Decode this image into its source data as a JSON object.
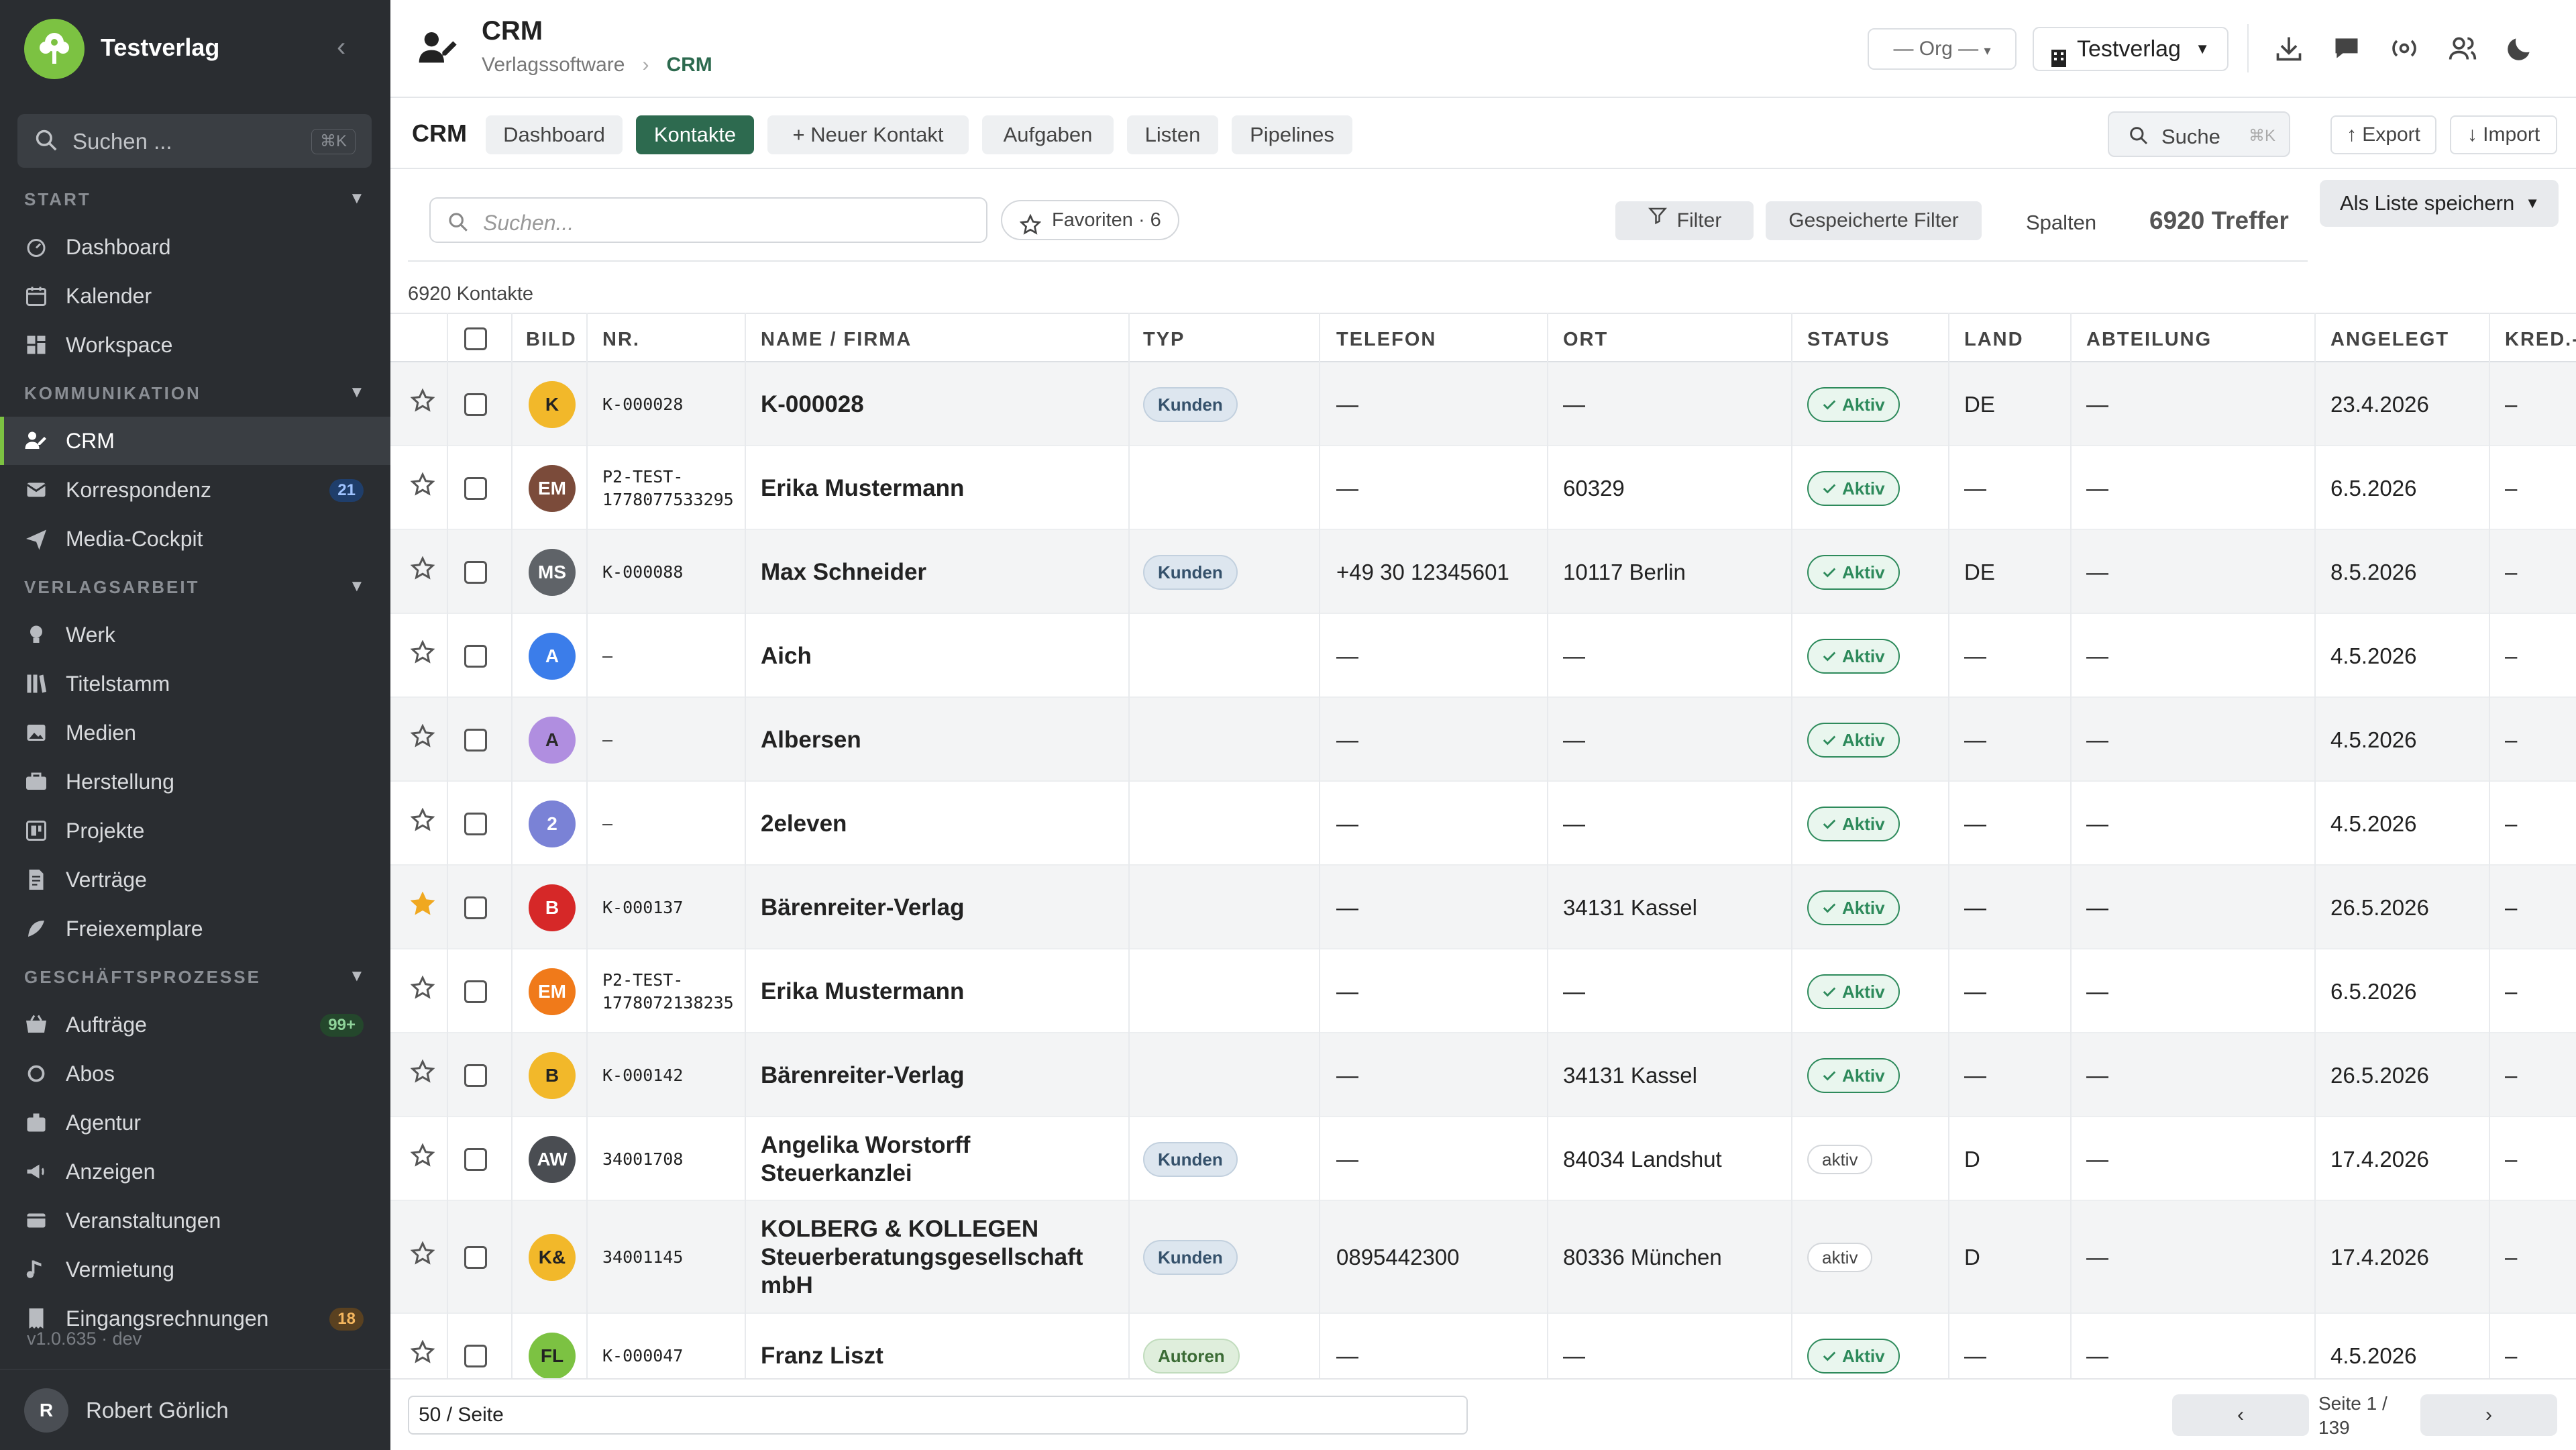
{
  "sidebar": {
    "brand": "Testverlag",
    "search_placeholder": "Suchen ...",
    "search_shortcut": "⌘K",
    "sections": [
      {
        "title": "START",
        "items": [
          {
            "label": "Dashboard",
            "icon": "dashboard-icon"
          },
          {
            "label": "Kalender",
            "icon": "calendar-icon"
          },
          {
            "label": "Workspace",
            "icon": "workspace-icon"
          }
        ]
      },
      {
        "title": "KOMMUNIKATION",
        "items": [
          {
            "label": "CRM",
            "icon": "crm-icon",
            "active": true
          },
          {
            "label": "Korrespondenz",
            "icon": "mail-icon",
            "badge": "21"
          },
          {
            "label": "Media-Cockpit",
            "icon": "send-icon"
          }
        ]
      },
      {
        "title": "VERLAGSARBEIT",
        "items": [
          {
            "label": "Werk",
            "icon": "bulb-icon"
          },
          {
            "label": "Titelstamm",
            "icon": "books-icon"
          },
          {
            "label": "Medien",
            "icon": "image-icon"
          },
          {
            "label": "Herstellung",
            "icon": "briefcase-icon"
          },
          {
            "label": "Projekte",
            "icon": "project-icon"
          },
          {
            "label": "Verträge",
            "icon": "contract-icon"
          },
          {
            "label": "Freiexemplare",
            "icon": "feather-icon"
          }
        ]
      },
      {
        "title": "GESCHÄFTSPROZESSE",
        "items": [
          {
            "label": "Aufträge",
            "icon": "orders-icon",
            "badge": "99+"
          },
          {
            "label": "Abos",
            "icon": "refresh-icon"
          },
          {
            "label": "Agentur",
            "icon": "agency-icon"
          },
          {
            "label": "Anzeigen",
            "icon": "megaphone-icon"
          },
          {
            "label": "Veranstaltungen",
            "icon": "event-icon"
          },
          {
            "label": "Vermietung",
            "icon": "music-icon"
          },
          {
            "label": "Eingangsrechnungen",
            "icon": "invoice-icon",
            "badge": "18"
          }
        ]
      }
    ],
    "version": "v1.0.635 · dev",
    "user": {
      "initial": "R",
      "name": "Robert Görlich"
    }
  },
  "header": {
    "title": "CRM",
    "breadcrumb": [
      "Verlagssoftware",
      "CRM"
    ],
    "org_select": "— Org —",
    "publisher_select": "Testverlag"
  },
  "subnav": {
    "title": "CRM",
    "tabs": [
      "Dashboard",
      "Kontakte",
      "+ Neuer Kontakt",
      "Aufgaben",
      "Listen",
      "Pipelines"
    ],
    "active_tab": "Kontakte",
    "search_label": "Suche",
    "search_shortcut": "⌘K",
    "export_label": "↑ Export",
    "import_label": "↓ Import"
  },
  "toolbar": {
    "search_placeholder": "Suchen...",
    "favorites_label": "Favoriten · 6",
    "filter_label": "Filter",
    "saved_filters_label": "Gespeicherte Filter",
    "columns_label": "Spalten",
    "hits": "6920 Treffer",
    "save_as_list": "Als Liste speichern"
  },
  "count_label": "6920 Kontakte",
  "table": {
    "columns": [
      "BILD",
      "NR.",
      "NAME / FIRMA",
      "TYP",
      "TELEFON",
      "ORT",
      "STATUS",
      "LAND",
      "ABTEILUNG",
      "ANGELEGT",
      "KRED.-"
    ],
    "rows": [
      {
        "initials": "K",
        "av_color": "#f2b82a",
        "av_text": "#222222",
        "nr": [
          "K-000028"
        ],
        "name": [
          "K-000028"
        ],
        "typ": "Kunden",
        "telefon": "—",
        "ort": "—",
        "status": "Aktiv",
        "land": "DE",
        "abteilung": "—",
        "angelegt": "23.4.2026",
        "kred": "–",
        "starred": false
      },
      {
        "initials": "EM",
        "av_color": "#7b4b3a",
        "av_text": "#ffffff",
        "nr": [
          "P2-TEST-",
          "1778077533295"
        ],
        "name": [
          "Erika Mustermann"
        ],
        "typ": "",
        "telefon": "—",
        "ort": "60329",
        "status": "Aktiv",
        "land": "—",
        "abteilung": "—",
        "angelegt": "6.5.2026",
        "kred": "–",
        "starred": false
      },
      {
        "initials": "MS",
        "av_color": "#5f6368",
        "av_text": "#ffffff",
        "nr": [
          "K-000088"
        ],
        "name": [
          "Max Schneider"
        ],
        "typ": "Kunden",
        "telefon": "+49 30 12345601",
        "ort": "10117 Berlin",
        "status": "Aktiv",
        "land": "DE",
        "abteilung": "—",
        "angelegt": "8.5.2026",
        "kred": "–",
        "starred": false
      },
      {
        "initials": "A",
        "av_color": "#3b7dea",
        "av_text": "#ffffff",
        "nr": [
          "–"
        ],
        "name": [
          "Aich"
        ],
        "typ": "",
        "telefon": "—",
        "ort": "—",
        "status": "Aktiv",
        "land": "—",
        "abteilung": "—",
        "angelegt": "4.5.2026",
        "kred": "–",
        "starred": false
      },
      {
        "initials": "A",
        "av_color": "#b08ee0",
        "av_text": "#2a2a2a",
        "nr": [
          "–"
        ],
        "name": [
          "Albersen"
        ],
        "typ": "",
        "telefon": "—",
        "ort": "—",
        "status": "Aktiv",
        "land": "—",
        "abteilung": "—",
        "angelegt": "4.5.2026",
        "kred": "–",
        "starred": false
      },
      {
        "initials": "2",
        "av_color": "#7a82d6",
        "av_text": "#ffffff",
        "nr": [
          "–"
        ],
        "name": [
          "2eleven"
        ],
        "typ": "",
        "telefon": "—",
        "ort": "—",
        "status": "Aktiv",
        "land": "—",
        "abteilung": "—",
        "angelegt": "4.5.2026",
        "kred": "–",
        "starred": false
      },
      {
        "initials": "B",
        "av_color": "#d62828",
        "av_text": "#ffffff",
        "nr": [
          "K-000137"
        ],
        "name": [
          "Bärenreiter-Verlag"
        ],
        "typ": "",
        "telefon": "—",
        "ort": "34131 Kassel",
        "status": "Aktiv",
        "land": "—",
        "abteilung": "—",
        "angelegt": "26.5.2026",
        "kred": "–",
        "starred": true
      },
      {
        "initials": "EM",
        "av_color": "#f07a1a",
        "av_text": "#ffffff",
        "nr": [
          "P2-TEST-",
          "1778072138235"
        ],
        "name": [
          "Erika Mustermann"
        ],
        "typ": "",
        "telefon": "—",
        "ort": "—",
        "status": "Aktiv",
        "land": "—",
        "abteilung": "—",
        "angelegt": "6.5.2026",
        "kred": "–",
        "starred": false
      },
      {
        "initials": "B",
        "av_color": "#f2b82a",
        "av_text": "#222222",
        "nr": [
          "K-000142"
        ],
        "name": [
          "Bärenreiter-Verlag"
        ],
        "typ": "",
        "telefon": "—",
        "ort": "34131 Kassel",
        "status": "Aktiv",
        "land": "—",
        "abteilung": "—",
        "angelegt": "26.5.2026",
        "kred": "–",
        "starred": false
      },
      {
        "initials": "AW",
        "av_color": "#4a4d52",
        "av_text": "#ffffff",
        "nr": [
          "34001708"
        ],
        "name": [
          "Angelika Worstorff",
          "Steuerkanzlei"
        ],
        "typ": "Kunden",
        "telefon": "—",
        "ort": "84034 Landshut",
        "status": "aktiv",
        "land": "D",
        "abteilung": "—",
        "angelegt": "17.4.2026",
        "kred": "–",
        "starred": false
      },
      {
        "initials": "K&",
        "av_color": "#f2b82a",
        "av_text": "#222222",
        "nr": [
          "34001145"
        ],
        "name": [
          "KOLBERG & KOLLEGEN",
          "Steuerberatungsgesellschaft",
          "mbH"
        ],
        "typ": "Kunden",
        "telefon": "0895442300",
        "ort": "80336 München",
        "status": "aktiv",
        "land": "D",
        "abteilung": "—",
        "angelegt": "17.4.2026",
        "kred": "–",
        "starred": false
      },
      {
        "initials": "FL",
        "av_color": "#7cc242",
        "av_text": "#222222",
        "nr": [
          "K-000047"
        ],
        "name": [
          "Franz Liszt"
        ],
        "typ": "Autoren",
        "telefon": "—",
        "ort": "—",
        "status": "Aktiv",
        "land": "—",
        "abteilung": "—",
        "angelegt": "4.5.2026",
        "kred": "–",
        "starred": false
      }
    ]
  },
  "pagination": {
    "per_page": "50 / Seite",
    "prev": "‹",
    "next": "›",
    "page_line1": "Seite 1 /",
    "page_line2": "139"
  }
}
